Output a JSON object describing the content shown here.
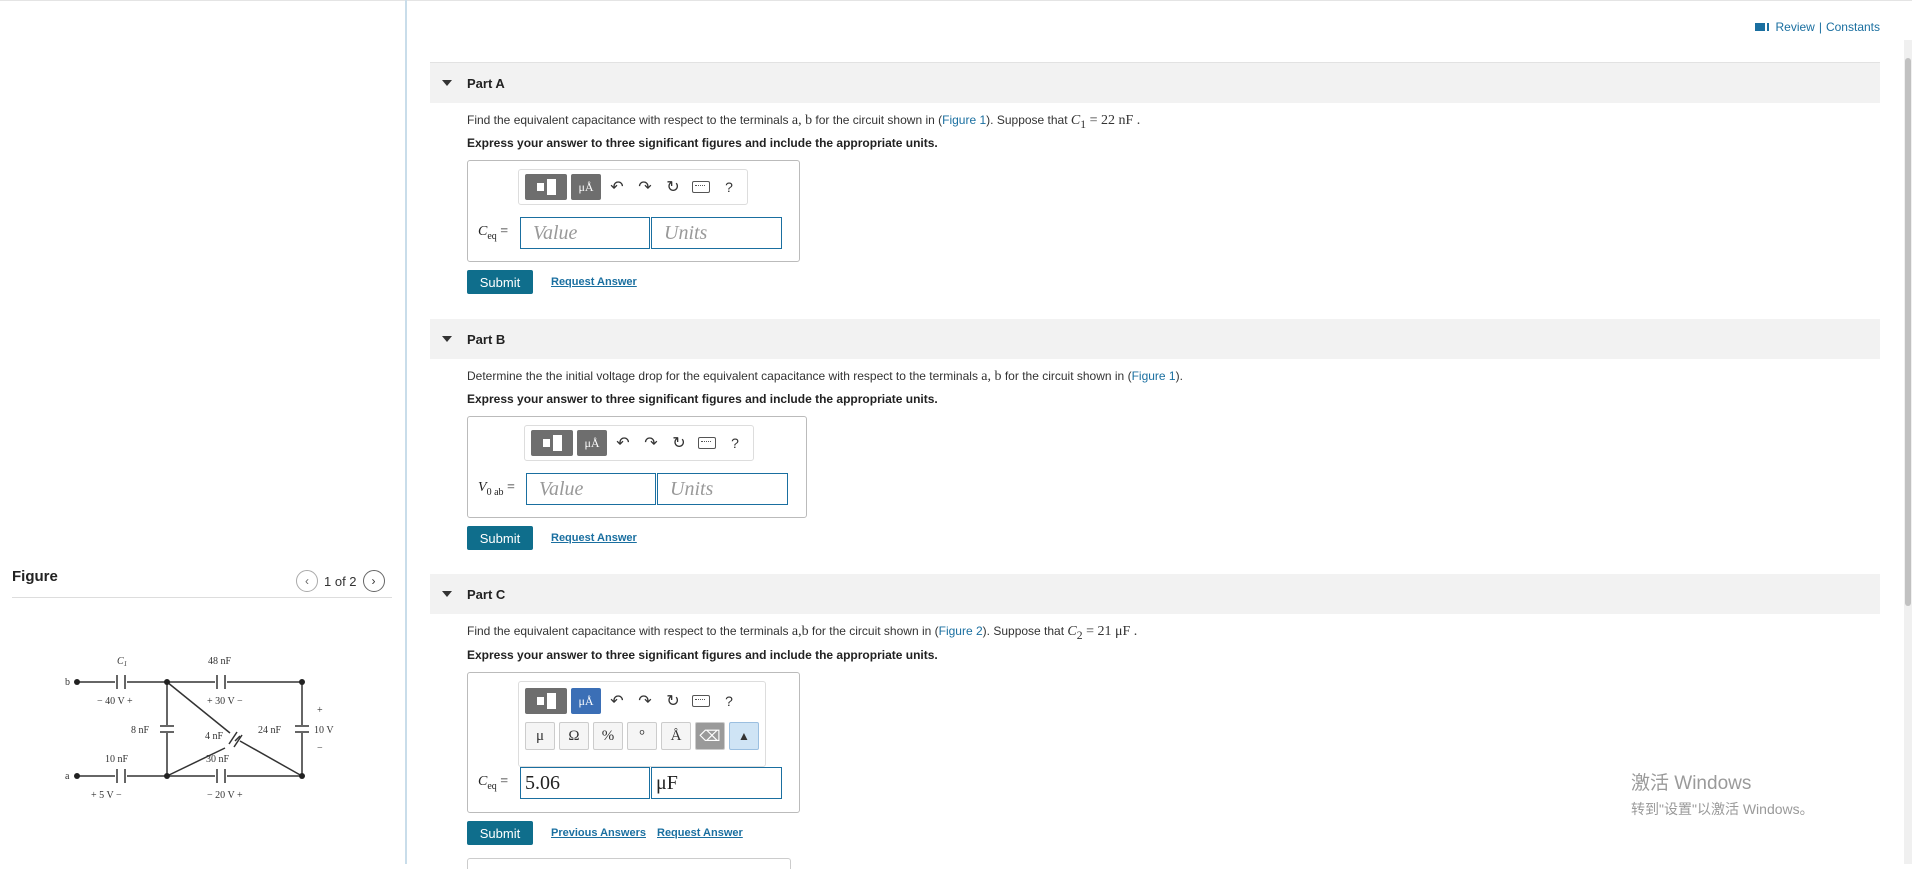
{
  "header": {
    "review_label": "Review",
    "separator": "|",
    "constants_label": "Constants"
  },
  "figure": {
    "title": "Figure",
    "pager": "1 of 2",
    "prev_icon": "chevron-left-icon",
    "next_icon": "chevron-right-icon",
    "labels": {
      "c1": "C",
      "c1_sub": "1",
      "c1_volt": "− 40 V  +",
      "c48": "48 nF",
      "c48_volt": "+  30 V  −",
      "c8": "8 nF",
      "c4": "4 nF",
      "c24": "24 nF",
      "v10_plus": "+",
      "v10": "10 V",
      "v10_minus": "−",
      "c10": "10 nF",
      "c10_volt": "+   5 V  −",
      "c30": "30 nF",
      "c30_volt": "−  20 V  +",
      "term_b": "b",
      "term_a": "a"
    }
  },
  "parts": [
    {
      "title": "Part A",
      "question_pre": "Find the equivalent capacitance with respect to the terminals",
      "terminals": "a, b",
      "question_mid": " for the circuit shown in (",
      "figure_link": "Figure 1",
      "question_post": "). Suppose that ",
      "math_var": "C",
      "math_sub": "1",
      "math_val": " = 22  nF .",
      "instructions": "Express your answer to three significant figures and include the appropriate units.",
      "var_main": "C",
      "var_sub": "eq",
      "var_eq": " =",
      "value_placeholder": "Value",
      "units_placeholder": "Units",
      "submit_label": "Submit",
      "request_label": "Request Answer"
    },
    {
      "title": "Part B",
      "question_pre": "Determine the the initial voltage drop for the equivalent capacitance with respect to the terminals",
      "terminals": "a, b",
      "question_mid": " for the circuit shown in (",
      "figure_link": "Figure 1",
      "question_post": ").",
      "instructions": "Express your answer to three significant figures and include the appropriate units.",
      "var_main": "V",
      "var_sub": "0 ab",
      "var_eq": " =",
      "value_placeholder": "Value",
      "units_placeholder": "Units",
      "submit_label": "Submit",
      "request_label": "Request Answer"
    },
    {
      "title": "Part C",
      "question_pre": "Find the equivalent capacitance with respect to the terminals",
      "terminals": "a,b",
      "question_mid": " for the circuit shown in (",
      "figure_link": "Figure 2",
      "question_post": "). Suppose that ",
      "math_var": "C",
      "math_sub": "2",
      "math_val": " = 21  μF .",
      "instructions": "Express your answer to three significant figures and include the appropriate units.",
      "var_main": "C",
      "var_sub": "eq",
      "var_eq": " =",
      "value": "5.06",
      "units": "μF",
      "submit_label": "Submit",
      "previous_label": "Previous Answers",
      "request_label": "Request Answer"
    }
  ],
  "toolbar": {
    "mu_label": "μÅ",
    "undo_icon": "undo-icon",
    "redo_icon": "redo-icon",
    "reset_icon": "reset-icon",
    "keyboard_icon": "keyboard-icon",
    "help_label": "?"
  },
  "symbols": {
    "mu": "μ",
    "omega": "Ω",
    "percent": "%",
    "degree": "°",
    "angstrom": "Å"
  },
  "watermark": {
    "line1": "激活 Windows",
    "line2": "转到\"设置\"以激活 Windows。"
  },
  "colors": {
    "accent": "#0f6e8c",
    "link": "#1a6fa0",
    "header_bg": "#f2f2f2"
  }
}
